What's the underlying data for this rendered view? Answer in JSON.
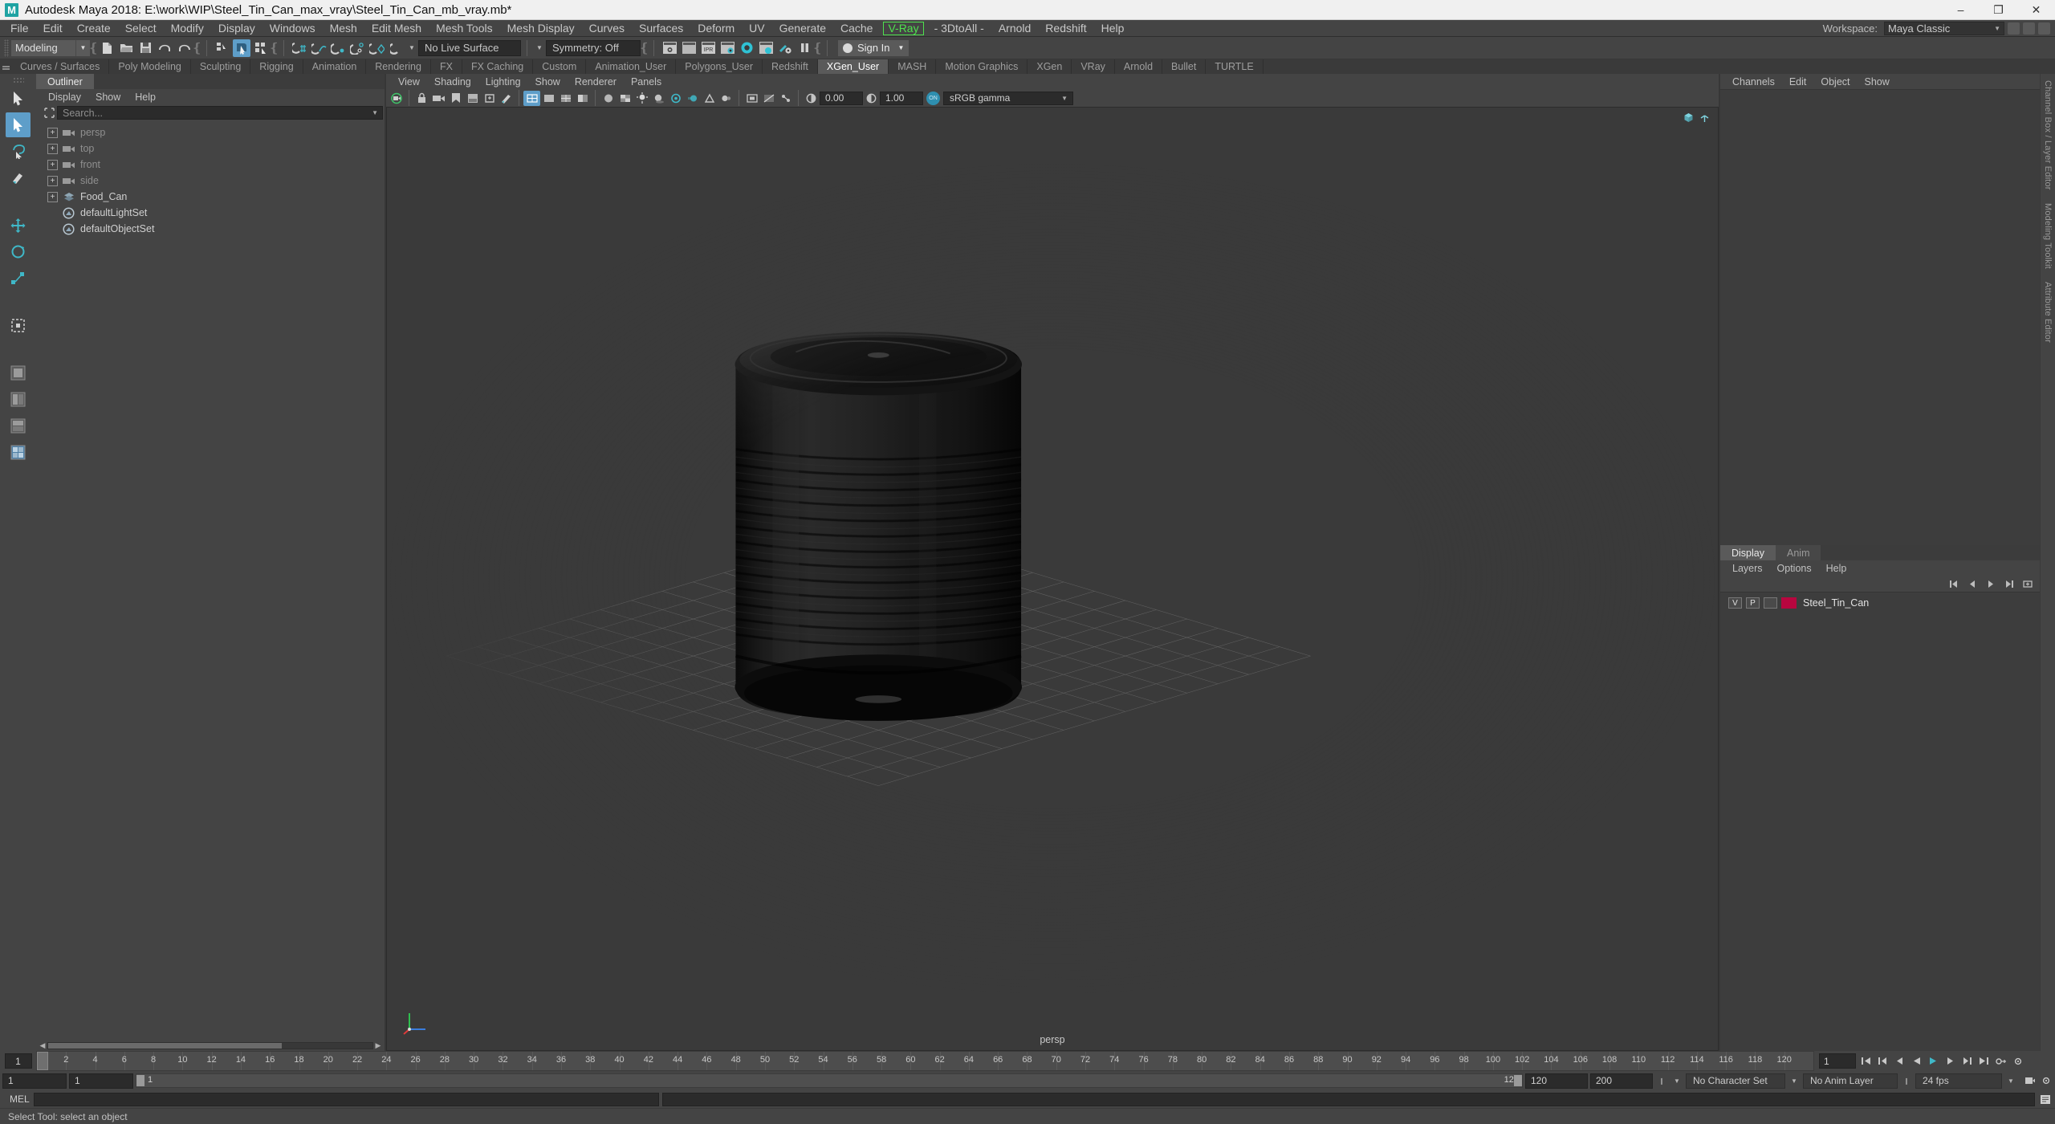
{
  "window": {
    "title": "Autodesk Maya 2018: E:\\work\\WIP\\Steel_Tin_Can_max_vray\\Steel_Tin_Can_mb_vray.mb*",
    "logo_letter": "M",
    "minimize": "–",
    "maximize": "❐",
    "close": "✕"
  },
  "menubar": {
    "items": [
      "File",
      "Edit",
      "Create",
      "Select",
      "Modify",
      "Display",
      "Windows",
      "Mesh",
      "Edit Mesh",
      "Mesh Tools",
      "Mesh Display",
      "Curves",
      "Surfaces",
      "Deform",
      "UV",
      "Generate",
      "Cache"
    ],
    "vray": "V-Ray",
    "items_after": [
      "- 3DtoAll -",
      "Arnold",
      "Redshift",
      "Help"
    ],
    "workspace_label": "Workspace:",
    "workspace_value": "Maya Classic"
  },
  "statusline": {
    "mode": "Modeling",
    "live_surface": "No Live Surface",
    "symmetry": "Symmetry: Off",
    "signin": "Sign In",
    "ipr_label": "IPR"
  },
  "shelf": {
    "tabs": [
      {
        "label": "Curves / Surfaces",
        "active": false
      },
      {
        "label": "Poly Modeling",
        "active": false
      },
      {
        "label": "Sculpting",
        "active": false
      },
      {
        "label": "Rigging",
        "active": false
      },
      {
        "label": "Animation",
        "active": false
      },
      {
        "label": "Rendering",
        "active": false
      },
      {
        "label": "FX",
        "active": false
      },
      {
        "label": "FX Caching",
        "active": false
      },
      {
        "label": "Custom",
        "active": false
      },
      {
        "label": "Animation_User",
        "active": false
      },
      {
        "label": "Polygons_User",
        "active": false
      },
      {
        "label": "Redshift",
        "active": false
      },
      {
        "label": "XGen_User",
        "active": true
      },
      {
        "label": "MASH",
        "active": false
      },
      {
        "label": "Motion Graphics",
        "active": false
      },
      {
        "label": "XGen",
        "active": false
      },
      {
        "label": "VRay",
        "active": false
      },
      {
        "label": "Arnold",
        "active": false
      },
      {
        "label": "Bullet",
        "active": false
      },
      {
        "label": "TURTLE",
        "active": false
      }
    ]
  },
  "outliner": {
    "tab_label": "Outliner",
    "menus": [
      "Display",
      "Show",
      "Help"
    ],
    "search_placeholder": "Search...",
    "items": [
      {
        "label": "persp",
        "icon": "camera-icon",
        "dim": true,
        "expandable": true,
        "indent": 0
      },
      {
        "label": "top",
        "icon": "camera-icon",
        "dim": true,
        "expandable": true,
        "indent": 0
      },
      {
        "label": "front",
        "icon": "camera-icon",
        "dim": true,
        "expandable": true,
        "indent": 0
      },
      {
        "label": "side",
        "icon": "camera-icon",
        "dim": true,
        "expandable": true,
        "indent": 0
      },
      {
        "label": "Food_Can",
        "icon": "mesh-icon",
        "dim": false,
        "expandable": true,
        "indent": 0
      },
      {
        "label": "defaultLightSet",
        "icon": "set-icon",
        "dim": false,
        "expandable": false,
        "indent": 1
      },
      {
        "label": "defaultObjectSet",
        "icon": "set-icon",
        "dim": false,
        "expandable": false,
        "indent": 1
      }
    ]
  },
  "viewport": {
    "menus": [
      "View",
      "Shading",
      "Lighting",
      "Show",
      "Renderer",
      "Panels"
    ],
    "exposure": "0.00",
    "gamma": "1.00",
    "color_profile": "sRGB gamma",
    "toggle_state": "ON",
    "camera_label": "persp",
    "background_color": "#3a3a3a",
    "object_name": "Food_Can"
  },
  "channelbox": {
    "menus": [
      "Channels",
      "Edit",
      "Object",
      "Show"
    ],
    "side_tabs": [
      "Channel Box / Layer Editor",
      "Modeling Toolkit",
      "Attribute Editor"
    ]
  },
  "layers": {
    "tabs": [
      {
        "label": "Display",
        "active": true
      },
      {
        "label": "Anim",
        "active": false
      }
    ],
    "menus": [
      "Layers",
      "Options",
      "Help"
    ],
    "rows": [
      {
        "visibility": "V",
        "playback": "P",
        "shading": "",
        "color": "#b8063f",
        "name": "Steel_Tin_Can"
      }
    ]
  },
  "timeline": {
    "current_frame": "1",
    "ticks": [
      "2",
      "4",
      "6",
      "8",
      "10",
      "12",
      "14",
      "16",
      "18",
      "20",
      "22",
      "24",
      "26",
      "28",
      "30",
      "32",
      "34",
      "36",
      "38",
      "40",
      "42",
      "44",
      "46",
      "48",
      "50",
      "52",
      "54",
      "56",
      "58",
      "60",
      "62",
      "64",
      "66",
      "68",
      "70",
      "72",
      "74",
      "76",
      "78",
      "80",
      "82",
      "84",
      "86",
      "88",
      "90",
      "92",
      "94",
      "96",
      "98",
      "100",
      "102",
      "104",
      "106",
      "108",
      "110",
      "112",
      "114",
      "116",
      "118",
      "120"
    ],
    "frame_field": "1",
    "playback_fps": "24 fps",
    "range_start": "1",
    "range_start2": "1",
    "range_bar_left": "1",
    "range_bar_right": "120",
    "range_end": "120",
    "anim_end": "200",
    "character_set": "No Character Set",
    "anim_layer": "No Anim Layer"
  },
  "commandline": {
    "mel_label": "MEL"
  },
  "statusbar": {
    "message": "Select Tool: select an object"
  }
}
